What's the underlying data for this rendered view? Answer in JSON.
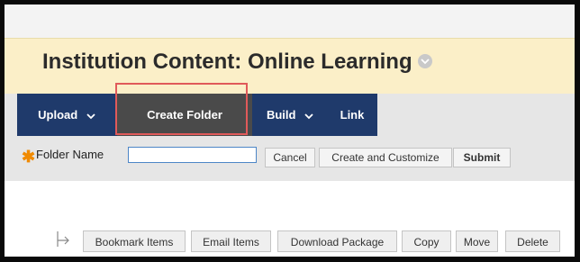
{
  "header": {
    "title": "Institution Content: Online Learning",
    "title_menu_icon": "chevron-down-icon"
  },
  "action_bar": {
    "upload_label": "Upload",
    "create_folder_label": "Create Folder",
    "build_label": "Build",
    "link_label": "Link"
  },
  "folder_form": {
    "name_label": "Folder Name",
    "name_value": "",
    "cancel_label": "Cancel",
    "create_customize_label": "Create and Customize",
    "submit_label": "Submit"
  },
  "bottom_actions": {
    "items": [
      "Bookmark Items",
      "Email Items",
      "Download Package",
      "Copy",
      "Move",
      "Delete"
    ]
  },
  "colors": {
    "title_bar_bg": "#fbefc8",
    "nav_bg": "#1f3a6b",
    "active_tab_bg": "#4a4a4a",
    "highlight_border": "#e05a5a",
    "required_star": "#f08a00"
  }
}
